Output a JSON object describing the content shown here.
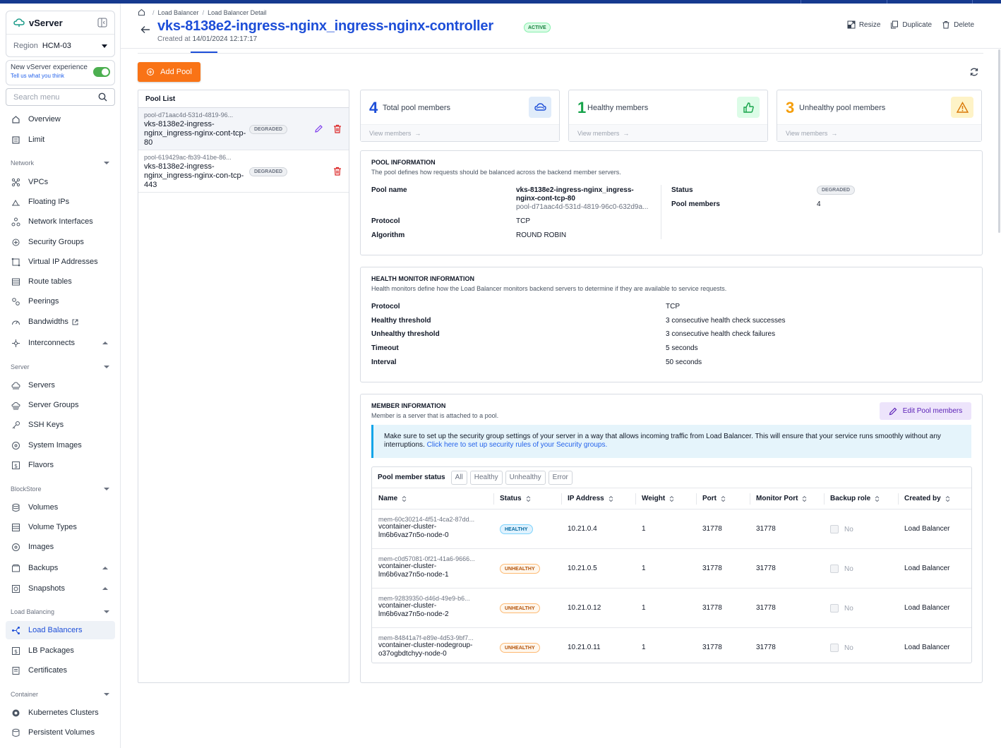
{
  "sidebar": {
    "brand": "vServer",
    "region_label": "Region",
    "region_value": "HCM-03",
    "experience_title": "New vServer experience",
    "experience_link": "Tell us what you think",
    "search_placeholder": "Search menu",
    "top_items": [
      "Overview",
      "Limit"
    ],
    "sections": {
      "network": "Network",
      "server": "Server",
      "blockstore": "BlockStore",
      "load_balancing": "Load Balancing",
      "container": "Container"
    },
    "network_items": [
      "VPCs",
      "Floating IPs",
      "Network Interfaces",
      "Security Groups",
      "Virtual IP Addresses",
      "Route tables",
      "Peerings",
      "Bandwidths",
      "Interconnects"
    ],
    "server_items": [
      "Servers",
      "Server Groups",
      "SSH Keys",
      "System Images",
      "Flavors"
    ],
    "blockstore_items": [
      "Volumes",
      "Volume Types",
      "Images",
      "Backups",
      "Snapshots"
    ],
    "lb_items": [
      "Load Balancers",
      "LB Packages",
      "Certificates"
    ],
    "container_items": [
      "Kubernetes Clusters",
      "Persistent Volumes"
    ]
  },
  "header": {
    "breadcrumb": [
      "Load Balancer",
      "Load Balancer Detail"
    ],
    "title": "vks-8138e2-ingress-nginx_ingress-nginx-controller",
    "status": "ACTIVE",
    "created_label": "Created at",
    "created_value": "14/01/2024 12:17:17",
    "actions": [
      "Resize",
      "Duplicate",
      "Delete"
    ]
  },
  "toolbar": {
    "add_pool": "Add Pool"
  },
  "pool_list": {
    "title": "Pool List",
    "items": [
      {
        "id": "pool-d71aac4d-531d-4819-96...",
        "name": "vks-8138e2-ingress-nginx_ingress-nginx-cont-tcp-80",
        "status": "DEGRADED"
      },
      {
        "id": "pool-619429ac-fb39-41be-86...",
        "name": "vks-8138e2-ingress-nginx_ingress-nginx-con-tcp-443",
        "status": "DEGRADED"
      }
    ]
  },
  "stats": [
    {
      "value": "4",
      "label": "Total pool members",
      "link": "View members",
      "color": "#1d4ed8"
    },
    {
      "value": "1",
      "label": "Healthy members",
      "link": "View members",
      "color": "#16a34a"
    },
    {
      "value": "3",
      "label": "Unhealthy pool members",
      "link": "View members",
      "color": "#f59e0b"
    }
  ],
  "pool_info": {
    "title": "POOL INFORMATION",
    "desc": "The pool defines how requests should be balanced across the backend member servers.",
    "name_label": "Pool name",
    "name_value": "vks-8138e2-ingress-nginx_ingress-nginx-cont-tcp-80",
    "name_id": "pool-d71aac4d-531d-4819-96c0-632d9a...",
    "protocol_label": "Protocol",
    "protocol_value": "TCP",
    "algorithm_label": "Algorithm",
    "algorithm_value": "ROUND ROBIN",
    "status_label": "Status",
    "status_value": "DEGRADED",
    "members_label": "Pool members",
    "members_value": "4"
  },
  "health": {
    "title": "HEALTH MONITOR INFORMATION",
    "desc": "Health monitors define how the Load Balancer monitors backend servers to determine if they are available to service requests.",
    "rows": [
      {
        "k": "Protocol",
        "v": "TCP"
      },
      {
        "k": "Healthy threshold",
        "v": "3 consecutive health check successes"
      },
      {
        "k": "Unhealthy threshold",
        "v": "3 consecutive health check failures"
      },
      {
        "k": "Timeout",
        "v": "5 seconds"
      },
      {
        "k": "Interval",
        "v": "50 seconds"
      }
    ]
  },
  "members": {
    "title": "MEMBER INFORMATION",
    "desc": "Member is a server that is attached to a pool.",
    "edit_button": "Edit Pool members",
    "notice": "Make sure to set up the security group settings of your server in a way that allows incoming traffic from Load Balancer. This will ensure that your service runs smoothly without any interruptions.",
    "notice_link": "Click here to set up security rules of your Security groups.",
    "filter_label": "Pool member status",
    "filters": [
      "All",
      "Healthy",
      "Unhealthy",
      "Error"
    ],
    "columns": [
      "Name",
      "Status",
      "IP Address",
      "Weight",
      "Port",
      "Monitor Port",
      "Backup role",
      "Created by"
    ],
    "rows": [
      {
        "id": "mem-60c30214-4f51-4ca2-87dd...",
        "name": "vcontainer-cluster-lm6b6vaz7n5o-node-0",
        "status": "HEALTHY",
        "ip": "10.21.0.4",
        "weight": "1",
        "port": "31778",
        "monitor": "31778",
        "backup": "No",
        "created": "Load Balancer"
      },
      {
        "id": "mem-c0d57081-0f21-41a6-9666...",
        "name": "vcontainer-cluster-lm6b6vaz7n5o-node-1",
        "status": "UNHEALTHY",
        "ip": "10.21.0.5",
        "weight": "1",
        "port": "31778",
        "monitor": "31778",
        "backup": "No",
        "created": "Load Balancer"
      },
      {
        "id": "mem-92839350-d46d-49e9-b6...",
        "name": "vcontainer-cluster-lm6b6vaz7n5o-node-2",
        "status": "UNHEALTHY",
        "ip": "10.21.0.12",
        "weight": "1",
        "port": "31778",
        "monitor": "31778",
        "backup": "No",
        "created": "Load Balancer"
      },
      {
        "id": "mem-84841a7f-e89e-4d53-9bf7...",
        "name": "vcontainer-cluster-nodegroup-o37ogbdtchyy-node-0",
        "status": "UNHEALTHY",
        "ip": "10.21.0.11",
        "weight": "1",
        "port": "31778",
        "monitor": "31778",
        "backup": "No",
        "created": "Load Balancer"
      }
    ]
  }
}
